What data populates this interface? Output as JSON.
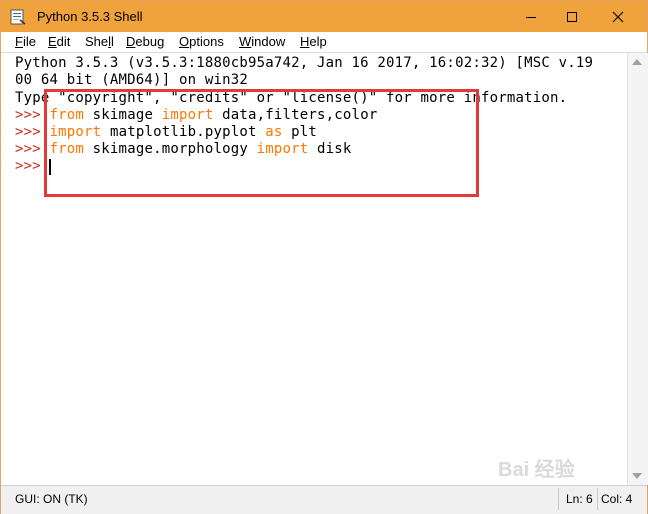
{
  "window": {
    "title": "Python 3.5.3 Shell",
    "accent_color": "#f0a23c"
  },
  "menu": {
    "file": {
      "underline": "F",
      "rest": "ile"
    },
    "edit": {
      "underline": "E",
      "rest": "dit"
    },
    "shell": {
      "prefix": "She",
      "underline": "l",
      "rest": "l"
    },
    "debug": {
      "underline": "D",
      "rest": "ebug"
    },
    "options": {
      "underline": "O",
      "rest": "ptions"
    },
    "window": {
      "underline": "W",
      "rest": "indow"
    },
    "help": {
      "underline": "H",
      "rest": "elp"
    }
  },
  "shell": {
    "banner_line1": "Python 3.5.3 (v3.5.3:1880cb95a742, Jan 16 2017, 16:02:32) [MSC v.19",
    "banner_line2": "00 64 bit (AMD64)] on win32",
    "banner_line3": "Type \"copyright\", \"credits\" or \"license()\" for more information.",
    "prompt": ">>>",
    "cmd1": {
      "kw1": "from",
      "mid": " skimage ",
      "kw2": "import",
      "rest": " data,filters,color"
    },
    "cmd2": {
      "kw1": "import",
      "mid": " matplotlib.pyplot ",
      "kw2": "as",
      "rest": " plt"
    },
    "cmd3": {
      "kw1": "from",
      "mid": " skimage.morphology ",
      "kw2": "import",
      "rest": " disk"
    }
  },
  "status": {
    "gui": "GUI: ON (TK)",
    "line": "Ln: 6",
    "col": "Col: 4"
  },
  "watermark": "Bai 经验"
}
